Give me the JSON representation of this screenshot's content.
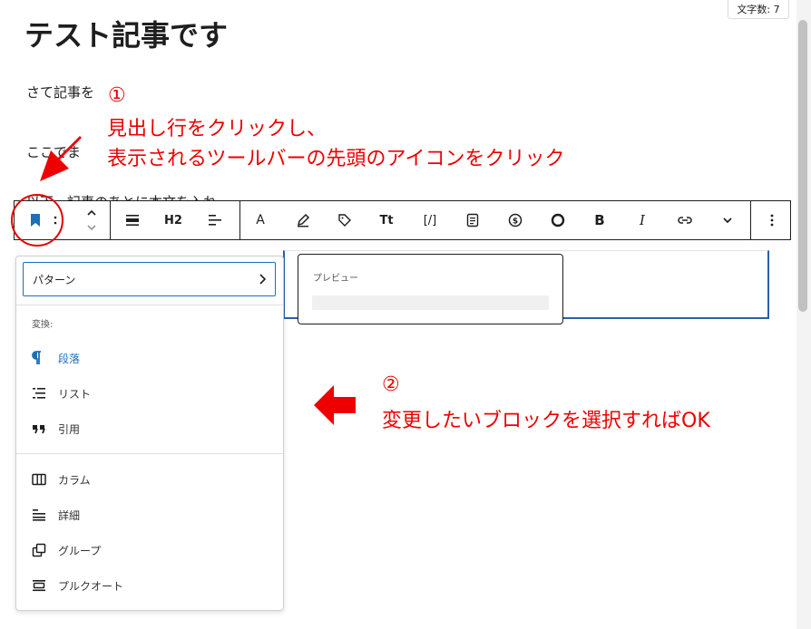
{
  "post": {
    "title": "テスト記事です",
    "paragraph1": "さて記事を",
    "paragraph2": "ここでま",
    "paragraph3": "以下、記事のあとに本文を入れ"
  },
  "word_count": "文字数: 7",
  "toolbar": {
    "heading_level": "H2",
    "buttons": [
      "bookmark-block-icon",
      "drag-handle-icon",
      "move-up-down-icon",
      "align-icon",
      "heading-level",
      "text-align-icon",
      "text-color-icon",
      "highlight-icon",
      "tag-icon",
      "font-size-icon",
      "shortcode-icon",
      "document-icon",
      "dollar-icon",
      "circle-icon",
      "bold-icon",
      "italic-icon",
      "link-icon",
      "chevron-down-icon",
      "more-options-icon"
    ],
    "bold": "B",
    "italic": "I",
    "font_size": "Tt",
    "shortcode": "[/]",
    "text_color": "A"
  },
  "dropdown": {
    "pattern_label": "パターン",
    "transform_heading": "変換:",
    "group1": [
      {
        "icon": "paragraph-icon",
        "label": "段落"
      },
      {
        "icon": "list-icon",
        "label": "リスト"
      },
      {
        "icon": "quote-icon",
        "label": "引用"
      }
    ],
    "group2": [
      {
        "icon": "columns-icon",
        "label": "カラム"
      },
      {
        "icon": "details-icon",
        "label": "詳細"
      },
      {
        "icon": "group-icon",
        "label": "グループ"
      },
      {
        "icon": "pullquote-icon",
        "label": "プルクオート"
      }
    ]
  },
  "preview": {
    "label": "プレビュー"
  },
  "annotations": {
    "step1_number": "①",
    "step1_line1": "見出し行をクリックし、",
    "step1_line2": "表示されるツールバーの先頭のアイコンをクリック",
    "step2_number": "②",
    "step2_text": "変更したいブロックを選択すればOK"
  },
  "colors": {
    "annotation": "#ee0000",
    "accent": "#1f6fb8"
  }
}
